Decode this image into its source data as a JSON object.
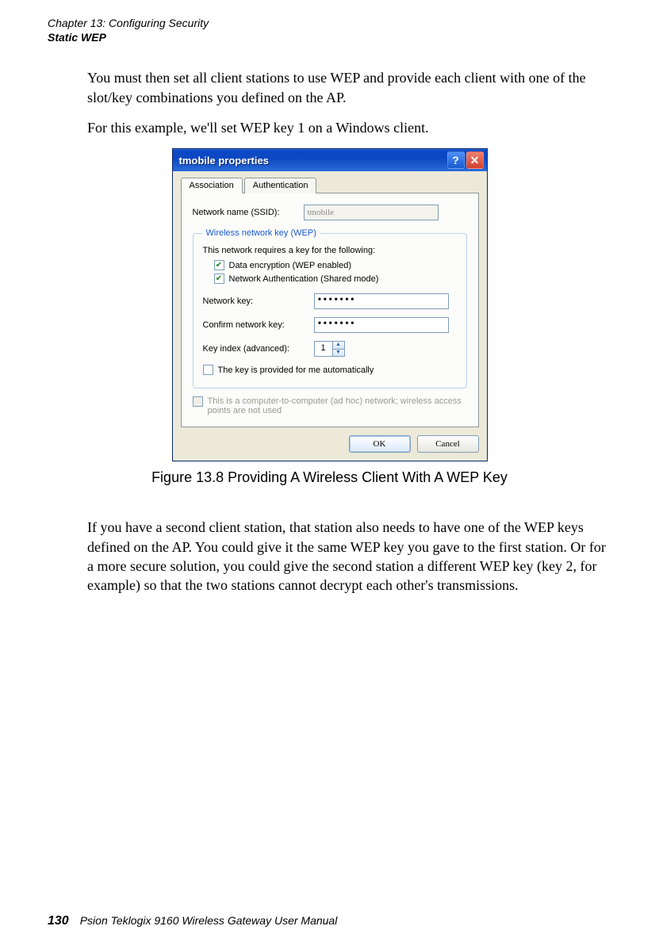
{
  "header": {
    "chapter": "Chapter 13:  Configuring Security",
    "topic": "Static WEP"
  },
  "para1": "You must then set all client stations to use WEP and provide each client with one of the slot/key combinations you defined on the AP.",
  "para2": "For this example, we'll set WEP key 1 on a Windows client.",
  "dialog": {
    "title": "tmobile properties",
    "tabs": {
      "assoc": "Association",
      "auth": "Authentication"
    },
    "ssid_label": "Network name (SSID):",
    "ssid_value": "tmobile",
    "group_legend": "Wireless network key (WEP)",
    "group_note": "This network requires a key for the following:",
    "chk_data": "Data encryption (WEP enabled)",
    "chk_auth": "Network Authentication (Shared mode)",
    "netkey_label": "Network key:",
    "netkey_value": "•••••••",
    "confirm_label": "Confirm network key:",
    "confirm_value": "•••••••",
    "keyidx_label": "Key index (advanced):",
    "keyidx_value": "1",
    "chk_auto": "The key is provided for me automatically",
    "adhoc_text": "This is a computer-to-computer (ad hoc) network; wireless access points are not used",
    "ok": "OK",
    "cancel": "Cancel"
  },
  "figure_caption": "Figure 13.8 Providing A Wireless Client With A WEP Key",
  "para3": "If you have a second client station, that station also needs to have one of the WEP keys defined on the AP. You could give it the same WEP key you gave to the first station. Or for a more secure solution, you could give the second station a different WEP key (key 2, for example) so that the two stations cannot decrypt each other's transmissions.",
  "footer": {
    "page": "130",
    "manual": "Psion Teklogix 9160 Wireless Gateway User Manual"
  }
}
